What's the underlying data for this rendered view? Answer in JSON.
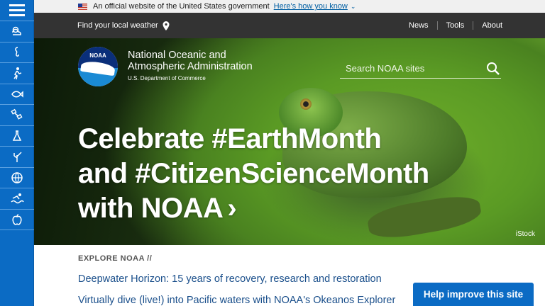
{
  "govbar": {
    "text": "An official website of the United States government",
    "link": "Here's how you know",
    "chevron": "⌄"
  },
  "topnav": {
    "weather": "Find your local weather",
    "links": [
      "News",
      "Tools",
      "About"
    ]
  },
  "sidebar": {
    "icons": [
      "weather-icon",
      "seahorse-icon",
      "hiker-icon",
      "fish-icon",
      "satellite-icon",
      "flask-icon",
      "coral-icon",
      "globe-icon",
      "swimmer-icon",
      "apple-icon"
    ]
  },
  "brand": {
    "logo_text": "NOAA",
    "name_line1": "National Oceanic and",
    "name_line2": "Atmospheric Administration",
    "dept": "U.S. Department of Commerce"
  },
  "search": {
    "placeholder": "Search NOAA sites"
  },
  "hero": {
    "line1": "Celebrate #EarthMonth",
    "line2": "and #CitizenScienceMonth",
    "line3": "with NOAA",
    "chevron": "›",
    "credit": "iStock"
  },
  "explore": {
    "heading": "EXPLORE NOAA //",
    "stories": [
      "Deepwater Horizon: 15 years of recovery, research and restoration",
      "Virtually dive (live!) into Pacific waters with NOAA's Okeanos Explorer"
    ]
  },
  "feedback": {
    "label": "Help improve this site"
  },
  "colors": {
    "primary": "#0b6bc4",
    "nav_bg": "#333333",
    "link": "#1a4f8b"
  }
}
